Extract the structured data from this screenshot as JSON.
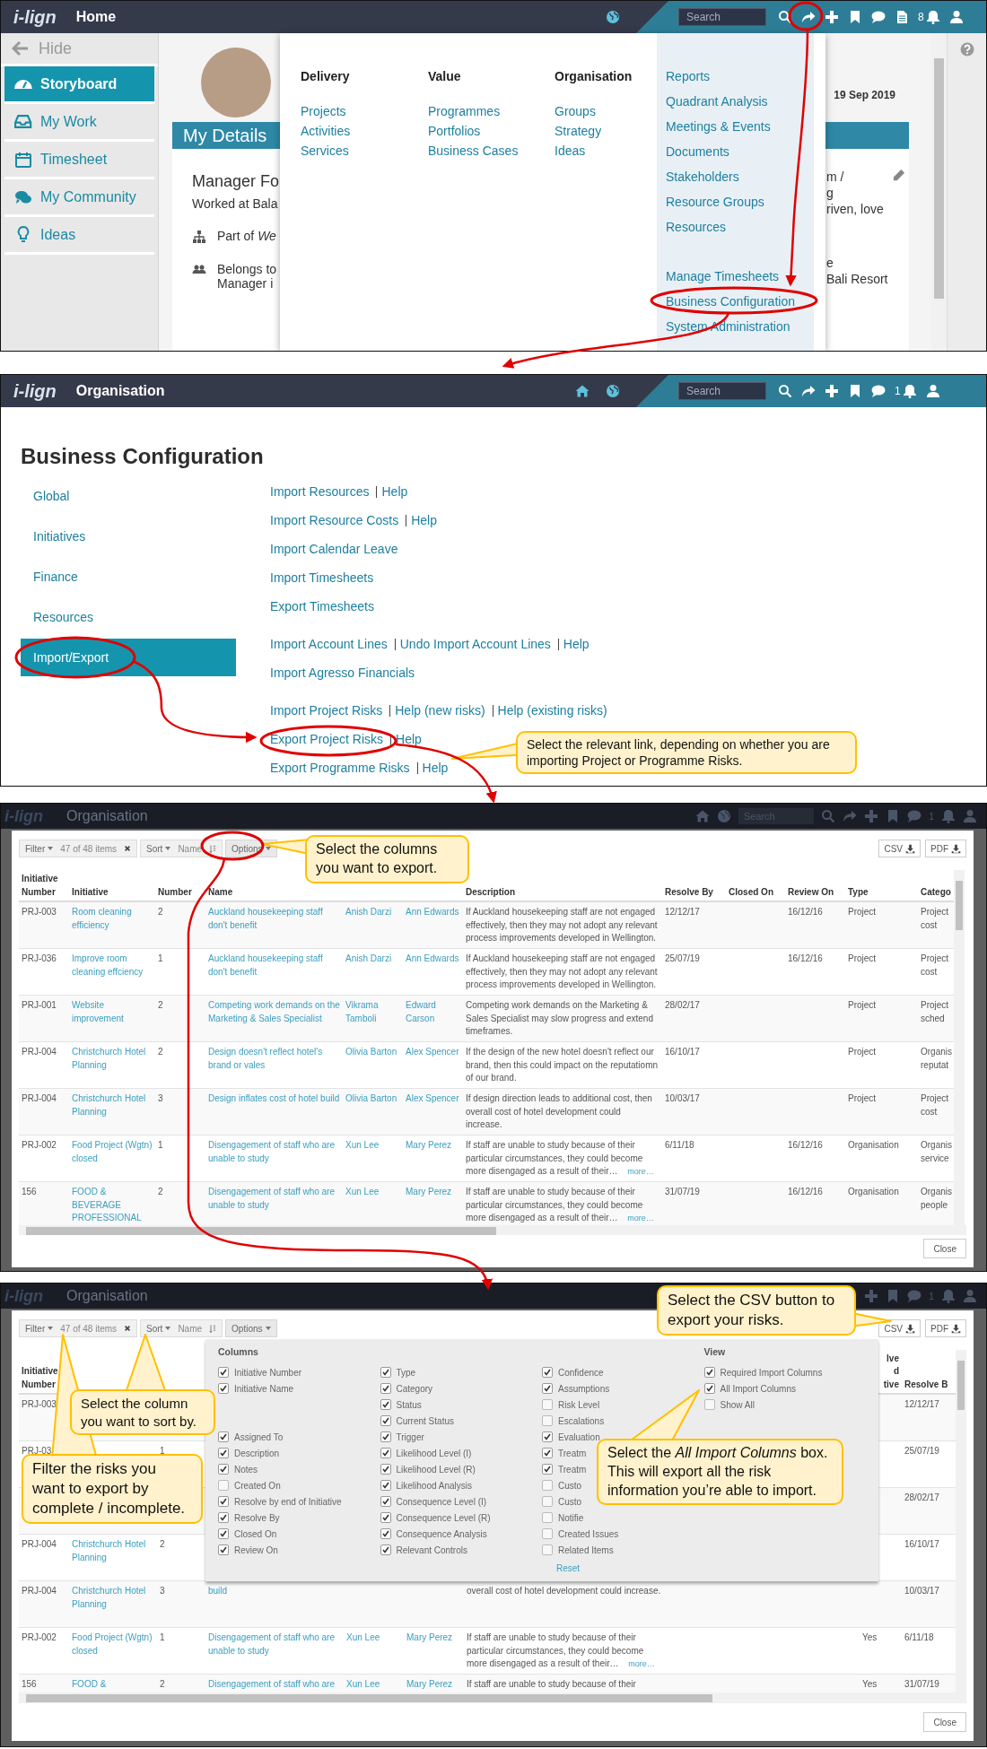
{
  "home_screen": {
    "top_bar": {
      "logo": "i-lign",
      "title": "Home",
      "search": {
        "placeholder": "Search"
      },
      "notification_count": "8"
    },
    "sidebar": {
      "hide_label": "Hide",
      "items": [
        {
          "label": "Storyboard",
          "selected": true
        },
        {
          "label": "My Work",
          "selected": false
        },
        {
          "label": "Timesheet",
          "selected": false
        },
        {
          "label": "My Community",
          "selected": false
        },
        {
          "label": "Ideas",
          "selected": false
        }
      ]
    },
    "profile": {
      "date": "19 Sep 2019",
      "section_title": "My Details",
      "role": "Manager Fo",
      "worked_at": "Worked at Bala",
      "part_of": "Part of *We*",
      "belongs_to": [
        "Belongs to",
        "Manager i"
      ],
      "right_lines": [
        "m /",
        "g",
        "riven, love"
      ],
      "right_lines_2": [
        "e",
        "Bali Resort"
      ]
    },
    "mega_menu": {
      "columns": [
        {
          "heading": "Delivery",
          "items": [
            "Projects",
            "Activities",
            "Services"
          ]
        },
        {
          "heading": "Value",
          "items": [
            "Programmes",
            "Portfolios",
            "Business Cases"
          ]
        },
        {
          "heading": "Organisation",
          "items": [
            "Groups",
            "Strategy",
            "Ideas"
          ]
        }
      ],
      "side_groups": [
        [
          "Reports",
          "Quadrant Analysis",
          "Meetings & Events",
          "Documents",
          "Stakeholders",
          "Resource Groups",
          "Resources"
        ],
        [
          "Manage Timesheets",
          "Business Configuration",
          "System Administration"
        ]
      ]
    }
  },
  "config_screen": {
    "top_bar": {
      "logo": "i-lign",
      "title": "Organisation",
      "search": {
        "placeholder": "Search"
      },
      "notification_count": "1"
    },
    "title": "Business Configuration",
    "nav": [
      {
        "label": "Global",
        "selected": false
      },
      {
        "label": "Initiatives",
        "selected": false
      },
      {
        "label": "Finance",
        "selected": false
      },
      {
        "label": "Resources",
        "selected": false
      },
      {
        "label": "Import/Export",
        "selected": true
      }
    ],
    "link_groups": [
      [
        [
          "Import Resources",
          "Help"
        ],
        [
          "Import Resource Costs",
          "Help"
        ],
        [
          "Import Calendar Leave"
        ],
        [
          "Import Timesheets"
        ],
        [
          "Export Timesheets"
        ]
      ],
      [
        [
          "Import Account Lines",
          "Undo Import Account Lines",
          "Help"
        ],
        [
          "Import Agresso Financials"
        ]
      ],
      [
        [
          "Import Project Risks",
          "Help (new risks)",
          "Help (existing risks)"
        ],
        [
          "Export Project Risks",
          "Help"
        ],
        [
          "Export Programme Risks",
          "Help"
        ]
      ]
    ],
    "callout": "Select the relevant link, depending on whether you are importing Project or Programme Risks."
  },
  "export_dialog": {
    "backdrop": {
      "logo": "i-lign",
      "title": "Organisation",
      "search": {
        "placeholder": "Search"
      },
      "notification_count": "1"
    },
    "toolbar": {
      "filter": "Filter",
      "count": "47 of 48 items",
      "sort": "Sort",
      "sort_field": "Name",
      "options": "Options"
    },
    "exports": [
      "CSV",
      "PDF"
    ],
    "columns": [
      {
        "label": "Initiative Number",
        "kind": "text"
      },
      {
        "label": "Initiative",
        "kind": "link"
      },
      {
        "label": "Number",
        "kind": "text"
      },
      {
        "label": "Name",
        "kind": "link"
      },
      {
        "kind": "link"
      },
      {
        "kind": "link"
      },
      {
        "label": "Description",
        "kind": "text"
      },
      {
        "label": "Resolve By",
        "kind": "text"
      },
      {
        "label": "Closed On"
      },
      {
        "label": "Review On",
        "kind": "text"
      },
      {
        "label": "Type",
        "kind": "text"
      },
      {
        "label": "Catego",
        "kind": "text"
      }
    ],
    "rows": [
      [
        "PRJ-003",
        "Room cleaning efficiency",
        "2",
        "Auckland housekeeping staff don't benefit",
        "Anish Darzi",
        "Ann Edwards",
        "If Auckland housekeeping staff are not engaged effectively, then they may not adopt any relevant process improvements developed in Wellington.",
        "12/12/17",
        null,
        "16/12/16",
        "Project",
        "Project cost"
      ],
      [
        "PRJ-036",
        "Improve room cleaning effciency",
        "1",
        "Auckland housekeeping staff don't benefit",
        "Anish Darzi",
        "Ann Edwards",
        "If Auckland housekeeping staff are not engaged effectively, then they may not adopt any relevant process improvements developed in Wellington.",
        "25/07/19",
        null,
        "16/12/16",
        "Project",
        "Project cost"
      ],
      [
        "PRJ-001",
        "Website improvement",
        "2",
        "Competing work demands on the Marketing & Sales Specialist",
        "Vikrama Tamboli",
        "Edward Carson",
        "Competing work demands on the Marketing & Sales Specialist may slow progress and extend timeframes.",
        "28/02/17",
        null,
        null,
        "Project",
        "Project sched"
      ],
      [
        "PRJ-004",
        "Christchurch Hotel Planning",
        "2",
        "Design doesn't reflect hotel's brand or vales",
        "Olivia Barton",
        "Alex Spencer",
        "If the design of the new hotel doesn't reflect our brand, then this could impact on the reputatiomn of our brand.",
        "16/10/17",
        null,
        null,
        "Project",
        "Organis reputat"
      ],
      [
        "PRJ-004",
        "Christchurch Hotel Planning",
        "3",
        "Design inflates cost of hotel build",
        "Olivia Barton",
        "Alex Spencer",
        "If design direction leads to additional cost, then overall cost of hotel development could increase.",
        "10/03/17",
        null,
        null,
        "Project",
        "Project cost"
      ],
      [
        "PRJ-002",
        "Food Project (Wgtn) closed",
        "1",
        "Disengagement of staff who are unable to study",
        "Xun Lee",
        "Mary Perez",
        {
          "text": "If staff are unable to study because of their particular circumstances, they could become more disengaged as a result of their…",
          "more": "more…"
        },
        "6/11/18",
        null,
        "16/12/16",
        "Organisation",
        "Organis service"
      ],
      [
        "156",
        "FOOD & BEVERAGE PROFESSIONAL",
        "2",
        "Disengagement of staff who are unable to study",
        "Xun Lee",
        "Mary Perez",
        {
          "text": "If staff are unable to study because of their particular circumstances, they could become more disengaged as a result of their…",
          "more": "more…"
        },
        "31/07/19",
        null,
        "16/12/16",
        "Organisation",
        "Organis people"
      ]
    ],
    "close": "Close",
    "callout": "Select the columns you want to export."
  },
  "options_dialog": {
    "backdrop": {
      "logo": "i-lign",
      "title": "Organisation",
      "notification_count": "1"
    },
    "toolbar": {
      "filter": "Filter",
      "count": "47 of 48 items",
      "sort": "Sort",
      "sort_field": "Name",
      "options": "Options"
    },
    "exports": [
      "CSV",
      "PDF"
    ],
    "columns": [
      {
        "label": "Initiative Number",
        "kind": "text"
      },
      {
        "kind": "link"
      },
      {
        "kind": "text"
      },
      {
        "kind": "link"
      },
      {
        "kind": "link"
      },
      {
        "kind": "link"
      },
      {
        "kind": "text"
      },
      {
        "label": "lve\nd\ntive",
        "kind": "text"
      },
      {
        "label": "Resolve B",
        "kind": "text"
      }
    ],
    "rows": [
      [
        "PRJ-003",
        null,
        null,
        null,
        null,
        null,
        null,
        null,
        "12/12/17"
      ],
      [
        "PRJ-03",
        null,
        "1",
        null,
        null,
        null,
        null,
        null,
        "25/07/19"
      ],
      [
        null,
        null,
        null,
        null,
        null,
        null,
        null,
        null,
        "28/02/17"
      ],
      [
        "PRJ-004",
        "Christchurch Hotel Planning",
        "2",
        null,
        null,
        null,
        null,
        null,
        "16/10/17"
      ],
      [
        "PRJ-004",
        "Christchurch Hotel Planning",
        "3",
        "build",
        null,
        null,
        "overall cost of hotel development could increase.",
        null,
        "10/03/17"
      ],
      [
        "PRJ-002",
        "Food Project (Wgtn) closed",
        "1",
        "Disengagement of staff who are unable to study",
        "Xun Lee",
        "Mary Perez",
        {
          "text": "If staff are unable to study because of their particular circumstances, they could become more disengaged as a result of their…",
          "more": "more…"
        },
        "Yes",
        "6/11/18"
      ],
      [
        "156",
        "FOOD &",
        "2",
        "Disengagement of staff who are",
        "Xun Lee",
        "Mary Perez",
        "If staff are unable to study because of their",
        "Yes",
        "31/07/19"
      ]
    ],
    "popover": {
      "columns_heading": "Columns",
      "view_heading": "View",
      "column_lists": [
        [
          {
            "kind": "check",
            "label": "Initiative Number",
            "checked": true
          },
          {
            "kind": "check",
            "label": "Initiative Name",
            "checked": true
          },
          {
            "kind": "covered"
          },
          {
            "kind": "covered"
          },
          {
            "kind": "check",
            "label": "Assigned To",
            "checked": true
          },
          {
            "kind": "check",
            "label": "Description",
            "checked": true
          },
          {
            "kind": "check",
            "label": "Notes",
            "checked": true
          },
          {
            "kind": "check",
            "label": "Created On",
            "checked": false
          },
          {
            "kind": "check",
            "label": "Resolve by end of Initiative",
            "checked": true
          },
          {
            "kind": "check",
            "label": "Resolve By",
            "checked": true
          },
          {
            "kind": "check",
            "label": "Closed On",
            "checked": true
          },
          {
            "kind": "check",
            "label": "Review On",
            "checked": true
          }
        ],
        [
          {
            "kind": "check",
            "label": "Type",
            "checked": true
          },
          {
            "kind": "check",
            "label": "Category",
            "checked": true
          },
          {
            "kind": "check",
            "label": "Status",
            "checked": true
          },
          {
            "kind": "check",
            "label": "Current Status",
            "checked": true
          },
          {
            "kind": "check",
            "label": "Trigger",
            "checked": true
          },
          {
            "kind": "check",
            "label": "Likelihood Level (I)",
            "checked": true
          },
          {
            "kind": "check",
            "label": "Likelihood Level (R)",
            "checked": true
          },
          {
            "kind": "check",
            "label": "Likelihood Analysis",
            "checked": true
          },
          {
            "kind": "check",
            "label": "Consequence Level (I)",
            "checked": true
          },
          {
            "kind": "check",
            "label": "Consequence Level (R)",
            "checked": true
          },
          {
            "kind": "check",
            "label": "Consequence Analysis",
            "checked": true
          },
          {
            "kind": "check",
            "label": "Relevant Controls",
            "checked": true
          }
        ],
        [
          {
            "kind": "check",
            "label": "Confidence",
            "checked": true
          },
          {
            "kind": "check",
            "label": "Assumptions",
            "checked": true
          },
          {
            "kind": "check",
            "label": "Risk Level",
            "checked": false
          },
          {
            "kind": "check",
            "label": "Escalations",
            "checked": false
          },
          {
            "kind": "check",
            "label": "Evaluation",
            "checked": true
          },
          {
            "kind": "check",
            "label": "Treatm",
            "checked": true
          },
          {
            "kind": "check",
            "label": "Treatm",
            "checked": true
          },
          {
            "kind": "check",
            "label": "Custo",
            "checked": false
          },
          {
            "kind": "check",
            "label": "Custo",
            "checked": false
          },
          {
            "kind": "check",
            "label": "Notifie",
            "checked": false
          },
          {
            "kind": "check",
            "label": "Created Issues",
            "checked": false
          },
          {
            "kind": "check",
            "label": "Related Items",
            "checked": false
          }
        ]
      ],
      "reset": "Reset",
      "view_items": [
        {
          "label": "Required Import Columns",
          "checked": true
        },
        {
          "label": "All Import Columns",
          "checked": true
        },
        {
          "label": "Show All",
          "checked": false
        }
      ]
    },
    "close": "Close",
    "callouts": [
      "Select the CSV button to export your risks.",
      "Select the column you want to sort by.",
      "Filter the risks you want to export by complete / incomplete.",
      "Select the *All Import Columns* box. This will export all the risk information you’re able to import."
    ]
  }
}
